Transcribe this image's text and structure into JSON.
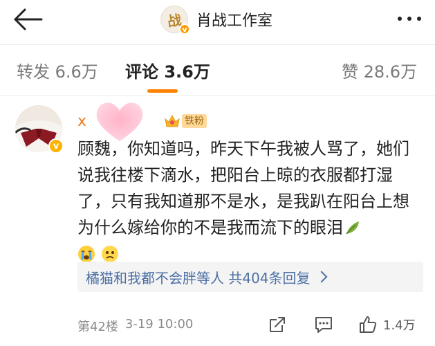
{
  "header": {
    "back_icon": "arrow-left-icon",
    "logo_glyph": "战",
    "logo_verified": "v",
    "title": "肖战工作室",
    "more_icon": "more-dots-icon"
  },
  "tabs": [
    {
      "label": "转发 6.6万",
      "active": false
    },
    {
      "label": "评论 3.6万",
      "active": true
    },
    {
      "label": "赞 28.6万",
      "active": false
    }
  ],
  "colors": {
    "accent": "#ff8200",
    "username": "#ef7a1f",
    "link": "#4b6fa3",
    "fan_badge": "#ffd89a"
  },
  "comment": {
    "username_visible": "x",
    "username_obscured_by": "pink-heart-sticker",
    "fan_badge": "铁粉",
    "text": "顾魏，你知道吗，昨天下午我被人骂了，她们说我往楼下滴水，把阳台上晾的衣服都打湿了，只有我知道那不是水，是我趴在阳台上想为什么嫁给你的不是我而流下的眼泪",
    "trailing_emoji": [
      "leaf-emoji",
      "crying-face-emoji",
      "sad-face-emoji"
    ],
    "replies_summary": "橘猫和我都不会胖等人  共404条回复",
    "floor": "第42楼",
    "timestamp": "3-19 10:00",
    "like_count": "1.4万"
  }
}
